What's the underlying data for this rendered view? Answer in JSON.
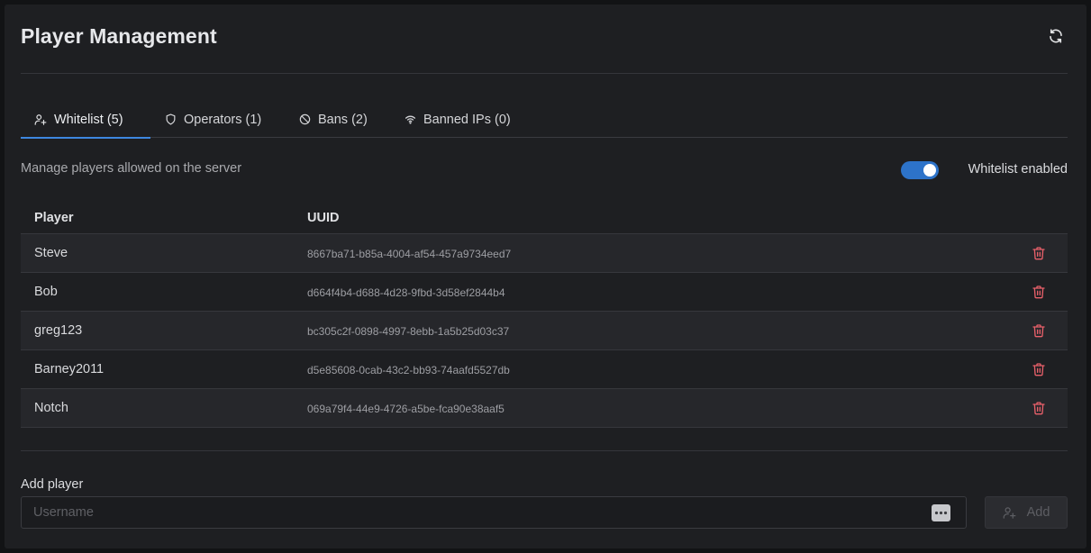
{
  "header": {
    "title": "Player Management"
  },
  "tabs": [
    {
      "label": "Whitelist (5)",
      "icon": "user-plus-icon",
      "active": true
    },
    {
      "label": "Operators (1)",
      "icon": "shield-icon",
      "active": false
    },
    {
      "label": "Bans (2)",
      "icon": "ban-icon",
      "active": false
    },
    {
      "label": "Banned IPs (0)",
      "icon": "wifi-icon",
      "active": false
    }
  ],
  "whitelist": {
    "description": "Manage players allowed on the server",
    "toggle_label": "Whitelist enabled",
    "enabled": true
  },
  "table": {
    "columns": [
      "Player",
      "UUID"
    ],
    "rows": [
      {
        "player": "Steve",
        "uuid": "8667ba71-b85a-4004-af54-457a9734eed7"
      },
      {
        "player": "Bob",
        "uuid": "d664f4b4-d688-4d28-9fbd-3d58ef2844b4"
      },
      {
        "player": "greg123",
        "uuid": "bc305c2f-0898-4997-8ebb-1a5b25d03c37"
      },
      {
        "player": "Barney2011",
        "uuid": "d5e85608-0cab-43c2-bb93-74aafd5527db"
      },
      {
        "player": "Notch",
        "uuid": "069a79f4-44e9-4726-a5be-fca90e38aaf5"
      }
    ]
  },
  "add_player": {
    "label": "Add player",
    "placeholder": "Username",
    "value": "",
    "button_label": "Add",
    "button_disabled": true
  },
  "colors": {
    "accent": "#3d87e0",
    "danger_icon": "#e8606a",
    "panel_bg": "#1e1f22"
  }
}
